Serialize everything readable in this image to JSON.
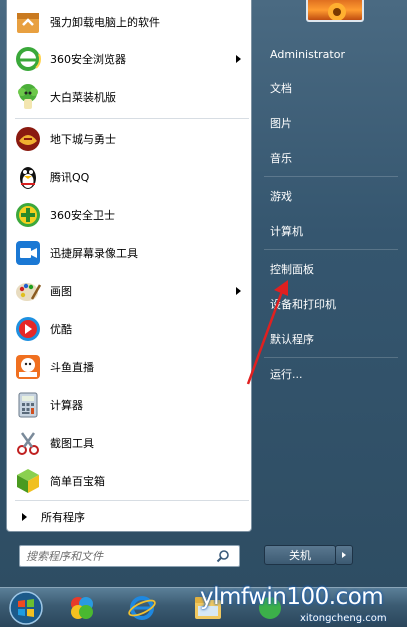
{
  "programs": [
    {
      "label": "强力卸载电脑上的软件",
      "icon": "uninstall-box-icon",
      "has_submenu": false
    },
    {
      "label": "360安全浏览器",
      "icon": "360-browser-icon",
      "has_submenu": true
    },
    {
      "label": "大白菜装机版",
      "icon": "dabaicai-icon",
      "has_submenu": false
    },
    {
      "label": "地下城与勇士",
      "icon": "dnf-icon",
      "has_submenu": false
    },
    {
      "label": "腾讯QQ",
      "icon": "qq-penguin-icon",
      "has_submenu": false
    },
    {
      "label": "360安全卫士",
      "icon": "360-safe-icon",
      "has_submenu": false
    },
    {
      "label": "迅捷屏幕录像工具",
      "icon": "screen-recorder-icon",
      "has_submenu": false
    },
    {
      "label": "画图",
      "icon": "paint-palette-icon",
      "has_submenu": true
    },
    {
      "label": "优酷",
      "icon": "youku-icon",
      "has_submenu": false
    },
    {
      "label": "斗鱼直播",
      "icon": "douyu-icon",
      "has_submenu": false
    },
    {
      "label": "计算器",
      "icon": "calculator-icon",
      "has_submenu": false
    },
    {
      "label": "截图工具",
      "icon": "snipping-tool-icon",
      "has_submenu": false
    },
    {
      "label": "简单百宝箱",
      "icon": "toolbox-cube-icon",
      "has_submenu": false
    }
  ],
  "all_programs": "所有程序",
  "search": {
    "placeholder": "搜索程序和文件"
  },
  "right_menu": [
    {
      "label": "Administrator"
    },
    {
      "label": "文档"
    },
    {
      "label": "图片"
    },
    {
      "label": "音乐"
    },
    {
      "label": "游戏"
    },
    {
      "label": "计算机"
    },
    {
      "label": "控制面板"
    },
    {
      "label": "设备和打印机"
    },
    {
      "label": "默认程序"
    },
    {
      "label": "运行..."
    }
  ],
  "shutdown_label": "关机",
  "watermark": {
    "main": "ylmfwin100.com",
    "sub": "xitongcheng.com"
  },
  "colors": {
    "annotation_arrow": "#e02020",
    "menu_text_right": "#ffffff"
  }
}
